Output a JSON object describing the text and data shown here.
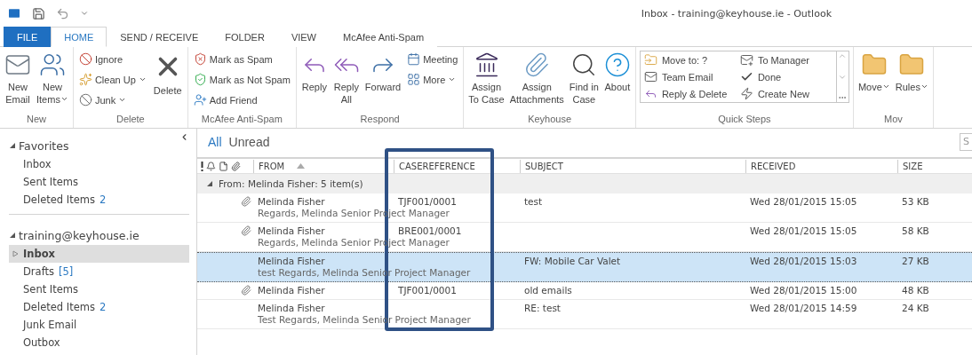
{
  "window": {
    "title": "Inbox - training@keyhouse.ie - Outlook"
  },
  "ribbon_tabs": [
    {
      "label": "FILE",
      "kind": "file",
      "selected": false
    },
    {
      "label": "HOME",
      "kind": "tab",
      "selected": true
    },
    {
      "label": "SEND / RECEIVE",
      "kind": "tab",
      "selected": false
    },
    {
      "label": "FOLDER",
      "kind": "tab",
      "selected": false
    },
    {
      "label": "VIEW",
      "kind": "tab",
      "selected": false
    },
    {
      "label": "McAfee Anti-Spam",
      "kind": "tab",
      "selected": false
    }
  ],
  "ribbon_groups": [
    {
      "label": "New",
      "items": [
        {
          "kind": "large",
          "label": "New\nEmail"
        },
        {
          "kind": "large",
          "label": "New\nItems",
          "dropdown": true
        }
      ]
    },
    {
      "label": "Delete",
      "items": [
        {
          "kind": "small",
          "label": "Ignore"
        },
        {
          "kind": "small",
          "label": "Clean Up",
          "dropdown": true
        },
        {
          "kind": "small",
          "label": "Junk",
          "dropdown": true
        },
        {
          "kind": "large",
          "label": "Delete"
        }
      ]
    },
    {
      "label": "McAfee Anti-Spam",
      "items": [
        {
          "kind": "small",
          "label": "Mark as Spam"
        },
        {
          "kind": "small",
          "label": "Mark as Not Spam"
        },
        {
          "kind": "small",
          "label": "Add Friend"
        }
      ]
    },
    {
      "label": "Respond",
      "items": [
        {
          "kind": "large",
          "label": "Reply"
        },
        {
          "kind": "large",
          "label": "Reply\nAll"
        },
        {
          "kind": "large",
          "label": "Forward"
        },
        {
          "kind": "small",
          "label": "Meeting"
        },
        {
          "kind": "small",
          "label": "More",
          "dropdown": true
        }
      ]
    },
    {
      "label": "Keyhouse",
      "items": [
        {
          "kind": "large",
          "label": "Assign\nTo Case"
        },
        {
          "kind": "large",
          "label": "Assign\nAttachments"
        },
        {
          "kind": "large",
          "label": "Find in\nCase"
        },
        {
          "kind": "large",
          "label": "About"
        }
      ]
    },
    {
      "label": "Quick Steps",
      "items": [
        {
          "kind": "gallery",
          "label": "Move to: ?"
        },
        {
          "kind": "gallery",
          "label": "To Manager"
        },
        {
          "kind": "gallery",
          "label": "Team Email"
        },
        {
          "kind": "gallery",
          "label": "Done"
        },
        {
          "kind": "gallery",
          "label": "Reply & Delete"
        },
        {
          "kind": "gallery",
          "label": "Create New"
        }
      ]
    },
    {
      "label": "Mov",
      "items": [
        {
          "kind": "large",
          "label": "Move",
          "dropdown": true
        },
        {
          "kind": "large",
          "label": "Rules",
          "dropdown": true
        }
      ]
    }
  ],
  "sidebar": {
    "sections": [
      {
        "label": "Favorites",
        "expanded": true,
        "items": [
          {
            "label": "Inbox",
            "selected": false
          },
          {
            "label": "Sent Items",
            "selected": false
          },
          {
            "label": "Deleted Items",
            "count": "2",
            "selected": false
          }
        ]
      },
      {
        "label": "training@keyhouse.ie",
        "expanded": true,
        "items": [
          {
            "label": "Inbox",
            "selected": true,
            "expandable": true
          },
          {
            "label": "Drafts",
            "count": "[5]",
            "selected": false
          },
          {
            "label": "Sent Items",
            "selected": false
          },
          {
            "label": "Deleted Items",
            "count": "2",
            "selected": false
          },
          {
            "label": "Junk Email",
            "selected": false
          },
          {
            "label": "Outbox",
            "selected": false
          }
        ]
      }
    ]
  },
  "mail_list": {
    "filters": [
      {
        "label": "All",
        "selected": true
      },
      {
        "label": "Unread",
        "selected": false
      }
    ],
    "search": {
      "placeholder": "S"
    },
    "columns": [
      {
        "label": "FROM",
        "sorted": true
      },
      {
        "label": "CASEREFERENCE",
        "highlighted": true
      },
      {
        "label": "SUBJECT"
      },
      {
        "label": "RECEIVED"
      },
      {
        "label": "SIZE"
      }
    ],
    "group": {
      "label": "From: Melinda Fisher: 5 item(s)",
      "expanded": true
    },
    "rows": [
      {
        "from": "Melinda Fisher",
        "preview": "Regards,  Melinda  Senior Project Manager",
        "casereference": "TJF001/0001",
        "subject": "test",
        "received": "Wed 28/01/2015 15:05",
        "size": "53 KB",
        "attachment": true,
        "selected": false
      },
      {
        "from": "Melinda Fisher",
        "preview": "Regards,  Melinda  Senior Project Manager",
        "casereference": "BRE001/0001",
        "received": "Wed 28/01/2015 15:05",
        "size": "58 KB",
        "attachment": true,
        "selected": false
      },
      {
        "from": "Melinda Fisher",
        "preview": "test  Regards,  Melinda  Senior Project Manager",
        "subject": "FW: Mobile Car Valet",
        "received": "Wed 28/01/2015 15:03",
        "size": "27 KB",
        "attachment": false,
        "selected": true
      },
      {
        "from": "Melinda Fisher",
        "casereference": "TJF001/0001",
        "subject": "old emails",
        "received": "Wed 28/01/2015 15:00",
        "size": "48 KB",
        "attachment": true,
        "selected": false
      },
      {
        "from": "Melinda Fisher",
        "preview": "Test  Regards,  Melinda  Senior Project Manager",
        "subject": "RE: test",
        "received": "Wed 28/01/2015 14:59",
        "size": "24 KB",
        "attachment": false,
        "selected": false
      }
    ]
  }
}
